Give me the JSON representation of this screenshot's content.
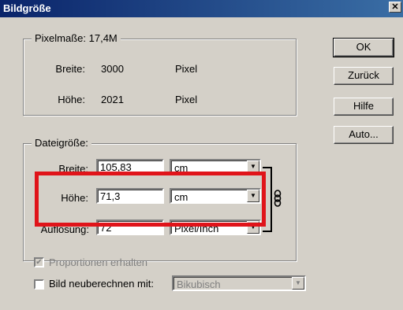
{
  "window": {
    "title": "Bildgröße",
    "close_glyph": "✕"
  },
  "pixel_dimensions": {
    "legend": "Pixelmaße: 17,4M",
    "width": {
      "label": "Breite:",
      "value": "3000",
      "unit": "Pixel"
    },
    "height": {
      "label": "Höhe:",
      "value": "2021",
      "unit": "Pixel"
    }
  },
  "document_size": {
    "legend": "Dateigröße:",
    "width": {
      "label": "Breite:",
      "value": "105,83",
      "unit": "cm"
    },
    "height": {
      "label": "Höhe:",
      "value": "71,3",
      "unit": "cm"
    },
    "resolution": {
      "label": "Auflösung:",
      "value": "72",
      "unit": "Pixel/Inch"
    }
  },
  "options": {
    "constrain_proportions": {
      "label": "Proportionen erhalten",
      "checked": true,
      "enabled": false
    },
    "resample": {
      "label": "Bild neuberechnen mit:",
      "checked": false,
      "method": "Bikubisch"
    }
  },
  "buttons": {
    "ok": "OK",
    "back": "Zurück",
    "help": "Hilfe",
    "auto": "Auto..."
  },
  "colors": {
    "highlight": "#e0141a",
    "dialog_bg": "#d4d0c8",
    "title_bar": "#0a246a"
  }
}
